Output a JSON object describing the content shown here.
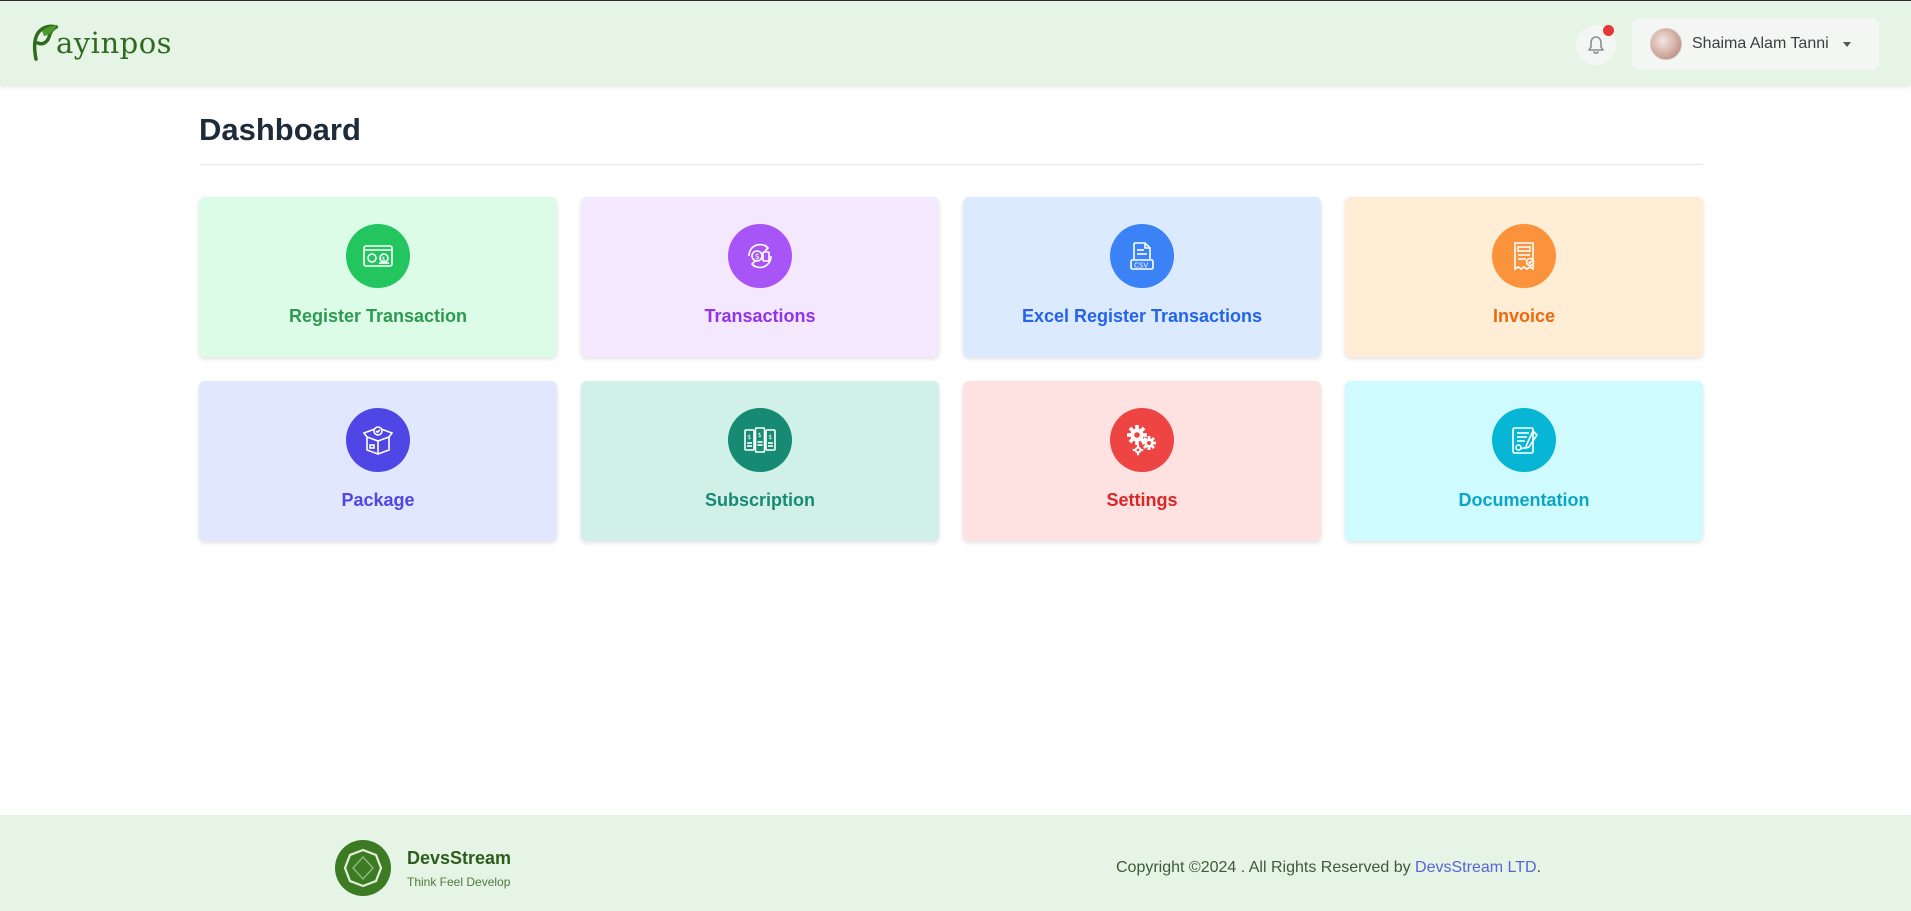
{
  "header": {
    "logo_initial": "P",
    "logo_text": "ayinpos",
    "user_name": "Shaima Alam Tanni"
  },
  "page": {
    "title": "Dashboard"
  },
  "cards": [
    {
      "label": "Register Transaction",
      "icon": "cash-register-icon",
      "bg": "#dcfce7",
      "accent": "#22c55e",
      "text": "#2e9a4f"
    },
    {
      "label": "Transactions",
      "icon": "currency-exchange-icon",
      "bg": "#f3e8ff",
      "accent": "#a855f7",
      "text": "#9333ea"
    },
    {
      "label": "Excel Register Transactions",
      "icon": "csv-file-icon",
      "bg": "#dbeafe",
      "accent": "#3b82f6",
      "text": "#2563eb"
    },
    {
      "label": "Invoice",
      "icon": "invoice-icon",
      "bg": "#ffedd5",
      "accent": "#fb923c",
      "text": "#ea6a12"
    },
    {
      "label": "Package",
      "icon": "package-box-icon",
      "bg": "#e0e7ff",
      "accent": "#4f46e5",
      "text": "#4f46e5"
    },
    {
      "label": "Subscription",
      "icon": "subscription-icon",
      "bg": "#d1f0e8",
      "accent": "#168a72",
      "text": "#168a72"
    },
    {
      "label": "Settings",
      "icon": "gears-icon",
      "bg": "#fee2e2",
      "accent": "#ef4444",
      "text": "#dc2626"
    },
    {
      "label": "Documentation",
      "icon": "document-signature-icon",
      "bg": "#cffafe",
      "accent": "#06b6d4",
      "text": "#0ea5c4"
    }
  ],
  "footer": {
    "brand_name": "DevsStream",
    "tagline": "Think Feel Develop",
    "copyright_prefix": "Copyright ©2024 . All Rights Reserved by ",
    "copyright_link": "DevsStream LTD",
    "copyright_suffix": "."
  }
}
